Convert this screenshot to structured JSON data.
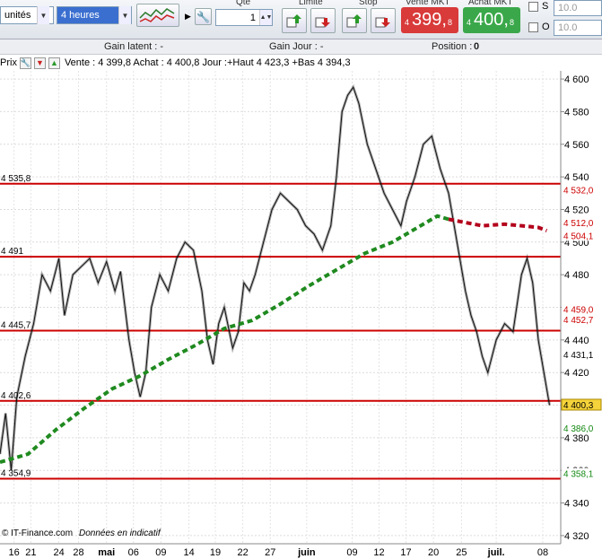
{
  "toolbar": {
    "units_value": "unités",
    "period_value": "4 heures",
    "qty_label": "Qté",
    "qty_value": "1",
    "limit_label": "Limite",
    "stop_label": "Stop",
    "sell_label": "Vente MKT",
    "sell_prefix": "4",
    "sell_price": "399,",
    "sell_suffix": "8",
    "buy_label": "Achat MKT",
    "buy_prefix": "4",
    "buy_price": "400,",
    "buy_suffix": "8",
    "s_label": "S",
    "o_label": "O",
    "s_value": "10.0",
    "o_value": "10.0",
    "sell_color": "#d93a3a",
    "buy_color": "#3aa84a"
  },
  "infobar": {
    "gain_latent": "Gain latent : -",
    "gain_jour": "Gain Jour : -",
    "position_label": "Position : ",
    "position_value": "0"
  },
  "quotebar": {
    "prix": "Prix",
    "quote": "Vente : 4 399,8 Achat : 4 400,8 Jour :+Haut 4 423,3 +Bas 4 394,3"
  },
  "watermark": {
    "source": "© IT-Finance.com",
    "note": "Données en indicatif"
  },
  "chart_data": {
    "type": "candlestick",
    "ylim": [
      4315,
      4605
    ],
    "yticks": [
      4600,
      4580,
      4560,
      4540,
      4520,
      4500,
      4480,
      4460,
      4440,
      4420,
      4400,
      4380,
      4360,
      4340,
      4320
    ],
    "ytick_labels": [
      "4 600",
      "4 580",
      "4 560",
      "4 540",
      "4 520",
      "4 500",
      "4 480",
      "4 460",
      "4 440",
      "4 420",
      "4 400",
      "4 380",
      "4 360",
      "4 340",
      "4 320"
    ],
    "xticks": [
      {
        "label": "16",
        "pos": 0.025
      },
      {
        "label": "21",
        "pos": 0.055
      },
      {
        "label": "24",
        "pos": 0.105
      },
      {
        "label": "28",
        "pos": 0.14
      },
      {
        "label": "mai",
        "pos": 0.19,
        "bold": true
      },
      {
        "label": "06",
        "pos": 0.238
      },
      {
        "label": "09",
        "pos": 0.287
      },
      {
        "label": "14",
        "pos": 0.337
      },
      {
        "label": "19",
        "pos": 0.384
      },
      {
        "label": "22",
        "pos": 0.433
      },
      {
        "label": "27",
        "pos": 0.482
      },
      {
        "label": "juin",
        "pos": 0.547,
        "bold": true
      },
      {
        "label": "09",
        "pos": 0.628
      },
      {
        "label": "12",
        "pos": 0.676
      },
      {
        "label": "17",
        "pos": 0.724
      },
      {
        "label": "20",
        "pos": 0.773
      },
      {
        "label": "25",
        "pos": 0.823
      },
      {
        "label": "juil.",
        "pos": 0.885,
        "bold": true
      },
      {
        "label": "08",
        "pos": 0.968
      }
    ],
    "hlines": [
      {
        "value": 4535.8,
        "label": "4 535,8"
      },
      {
        "value": 4491,
        "label": "4 491"
      },
      {
        "value": 4445.7,
        "label": "4 445,7"
      },
      {
        "value": 4402.6,
        "label": "4 402,6"
      },
      {
        "value": 4354.9,
        "label": "4 354,9"
      }
    ],
    "price_path": [
      [
        0.0,
        4370
      ],
      [
        0.01,
        4395
      ],
      [
        0.02,
        4360
      ],
      [
        0.03,
        4405
      ],
      [
        0.045,
        4430
      ],
      [
        0.06,
        4450
      ],
      [
        0.075,
        4480
      ],
      [
        0.09,
        4470
      ],
      [
        0.105,
        4490
      ],
      [
        0.115,
        4455
      ],
      [
        0.13,
        4480
      ],
      [
        0.145,
        4485
      ],
      [
        0.16,
        4490
      ],
      [
        0.175,
        4475
      ],
      [
        0.19,
        4488
      ],
      [
        0.205,
        4470
      ],
      [
        0.215,
        4482
      ],
      [
        0.23,
        4440
      ],
      [
        0.24,
        4420
      ],
      [
        0.25,
        4405
      ],
      [
        0.26,
        4420
      ],
      [
        0.27,
        4460
      ],
      [
        0.285,
        4480
      ],
      [
        0.3,
        4470
      ],
      [
        0.315,
        4490
      ],
      [
        0.33,
        4500
      ],
      [
        0.345,
        4495
      ],
      [
        0.36,
        4470
      ],
      [
        0.37,
        4440
      ],
      [
        0.38,
        4425
      ],
      [
        0.39,
        4450
      ],
      [
        0.4,
        4460
      ],
      [
        0.415,
        4435
      ],
      [
        0.425,
        4445
      ],
      [
        0.435,
        4475
      ],
      [
        0.445,
        4470
      ],
      [
        0.455,
        4480
      ],
      [
        0.47,
        4500
      ],
      [
        0.485,
        4520
      ],
      [
        0.5,
        4530
      ],
      [
        0.515,
        4525
      ],
      [
        0.53,
        4520
      ],
      [
        0.545,
        4510
      ],
      [
        0.56,
        4505
      ],
      [
        0.575,
        4495
      ],
      [
        0.59,
        4510
      ],
      [
        0.6,
        4540
      ],
      [
        0.61,
        4580
      ],
      [
        0.62,
        4590
      ],
      [
        0.63,
        4595
      ],
      [
        0.64,
        4585
      ],
      [
        0.655,
        4560
      ],
      [
        0.67,
        4545
      ],
      [
        0.685,
        4530
      ],
      [
        0.7,
        4520
      ],
      [
        0.715,
        4510
      ],
      [
        0.725,
        4525
      ],
      [
        0.74,
        4540
      ],
      [
        0.755,
        4560
      ],
      [
        0.77,
        4565
      ],
      [
        0.785,
        4545
      ],
      [
        0.8,
        4530
      ],
      [
        0.81,
        4510
      ],
      [
        0.82,
        4490
      ],
      [
        0.83,
        4470
      ],
      [
        0.84,
        4455
      ],
      [
        0.85,
        4445
      ],
      [
        0.86,
        4430
      ],
      [
        0.87,
        4420
      ],
      [
        0.885,
        4440
      ],
      [
        0.9,
        4450
      ],
      [
        0.915,
        4445
      ],
      [
        0.93,
        4480
      ],
      [
        0.94,
        4490
      ],
      [
        0.95,
        4475
      ],
      [
        0.96,
        4440
      ],
      [
        0.97,
        4420
      ],
      [
        0.98,
        4400
      ]
    ],
    "ma_green_path": [
      [
        0.0,
        4365
      ],
      [
        0.05,
        4370
      ],
      [
        0.1,
        4385
      ],
      [
        0.15,
        4398
      ],
      [
        0.2,
        4410
      ],
      [
        0.25,
        4418
      ],
      [
        0.3,
        4428
      ],
      [
        0.35,
        4437
      ],
      [
        0.4,
        4447
      ],
      [
        0.45,
        4452
      ],
      [
        0.5,
        4462
      ],
      [
        0.55,
        4473
      ],
      [
        0.6,
        4483
      ],
      [
        0.65,
        4493
      ],
      [
        0.7,
        4500
      ],
      [
        0.75,
        4510
      ],
      [
        0.78,
        4516
      ],
      [
        0.8,
        4514
      ]
    ],
    "ma_red_path": [
      [
        0.8,
        4514
      ],
      [
        0.83,
        4512
      ],
      [
        0.86,
        4510
      ],
      [
        0.9,
        4511
      ],
      [
        0.93,
        4510
      ],
      [
        0.96,
        4509
      ],
      [
        0.975,
        4507
      ]
    ],
    "tags": [
      {
        "value": 4532.0,
        "label": "4 532,0",
        "color": "#cc0000",
        "bg": "#ffffff"
      },
      {
        "value": 4512.0,
        "label": "4 512,0",
        "color": "#cc0000",
        "bg": "#ffffff"
      },
      {
        "value": 4504.1,
        "label": "4 504,1",
        "color": "#cc0000",
        "bg": "#ffffff"
      },
      {
        "value": 4459.0,
        "label": "4 459,0",
        "color": "#cc0000",
        "bg": "#ffffff"
      },
      {
        "value": 4452.7,
        "label": "4 452,7",
        "color": "#cc0000",
        "bg": "#ffffff"
      },
      {
        "value": 4431.1,
        "label": "4 431,1",
        "color": "#000000",
        "bg": "#ffffff"
      },
      {
        "value": 4400.3,
        "label": "4 400,3",
        "color": "#000000",
        "bg": "#f5d33a"
      },
      {
        "value": 4386.0,
        "label": "4 386,0",
        "color": "#118811",
        "bg": "#ffffff"
      },
      {
        "value": 4358.1,
        "label": "4 358,1",
        "color": "#118811",
        "bg": "#ffffff"
      }
    ]
  }
}
